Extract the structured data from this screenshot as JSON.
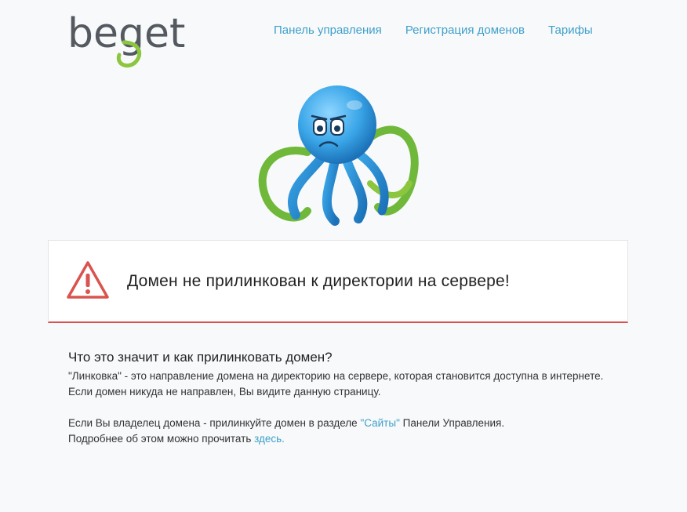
{
  "header": {
    "logo_text": "beget",
    "nav": [
      {
        "label": "Панель управления"
      },
      {
        "label": "Регистрация доменов"
      },
      {
        "label": "Тарифы"
      }
    ]
  },
  "alert": {
    "message": "Домен не прилинкован к директории на сервере!",
    "icon": "warning-triangle-icon"
  },
  "info": {
    "title": "Что это значит и как прилинковать домен?",
    "para1": "\"Линковка\" - это направление домена на директорию на сервере, которая становится доступна в интернете. Если домен никуда не направлен, Вы видите данную страницу.",
    "para2_before": "Если Вы владелец домена - прилинкуйте домен в разделе ",
    "para2_link": "\"Сайты\"",
    "para2_after": " Панели Управления.",
    "para3_before": "Подробнее об этом можно прочитать ",
    "para3_link": "здесь."
  },
  "colors": {
    "background": "#f8f9fb",
    "link": "#3ea0c9",
    "alert_accent": "#d9534f",
    "logo_gray": "#555a60",
    "logo_green": "#8cc63f"
  }
}
